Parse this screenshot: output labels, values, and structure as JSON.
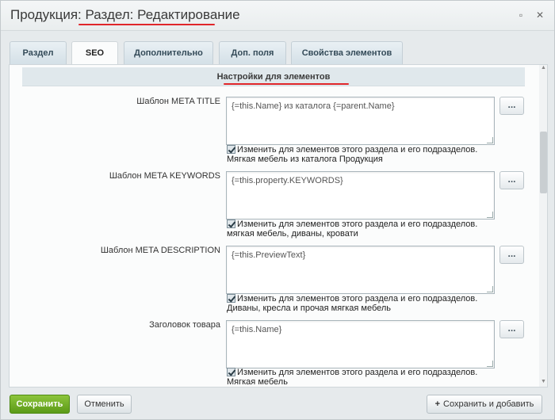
{
  "window": {
    "title": "Продукция: Раздел: Редактирование",
    "minimize_glyph": "▫",
    "close_glyph": "✕"
  },
  "tabs": [
    {
      "label": "Раздел",
      "active": false
    },
    {
      "label": "SEO",
      "active": true
    },
    {
      "label": "Дополнительно",
      "active": false
    },
    {
      "label": "Доп. поля",
      "active": false
    },
    {
      "label": "Свойства элементов",
      "active": false
    }
  ],
  "section": {
    "header": "Настройки для элементов"
  },
  "fields": [
    {
      "label": "Шаблон META TITLE",
      "value": "{=this.Name} из каталога {=parent.Name}",
      "checkbox_label": "Изменить для элементов этого раздела и его подразделов.",
      "checked": true,
      "preview": "Мягкая мебель из каталога Продукция"
    },
    {
      "label": "Шаблон META KEYWORDS",
      "value": "{=this.property.KEYWORDS}",
      "checkbox_label": "Изменить для элементов этого раздела и его подразделов.",
      "checked": true,
      "preview": "мягкая мебель, диваны, кровати"
    },
    {
      "label": "Шаблон META DESCRIPTION",
      "value": "{=this.PreviewText}",
      "checkbox_label": "Изменить для элементов этого раздела и его подразделов.",
      "checked": true,
      "preview": "Диваны, кресла и прочая мягкая мебель"
    },
    {
      "label": "Заголовок товара",
      "value": "{=this.Name}",
      "checkbox_label": "Изменить для элементов этого раздела и его подразделов.",
      "checked": true,
      "preview": "Мягкая мебель"
    }
  ],
  "dots_button_label": "...",
  "footer": {
    "save": "Сохранить",
    "cancel": "Отменить",
    "save_and_add": "Сохранить и добавить",
    "plus_glyph": "+"
  },
  "colors": {
    "accent_underline": "#e0262a",
    "save_button": "#6aa824"
  }
}
